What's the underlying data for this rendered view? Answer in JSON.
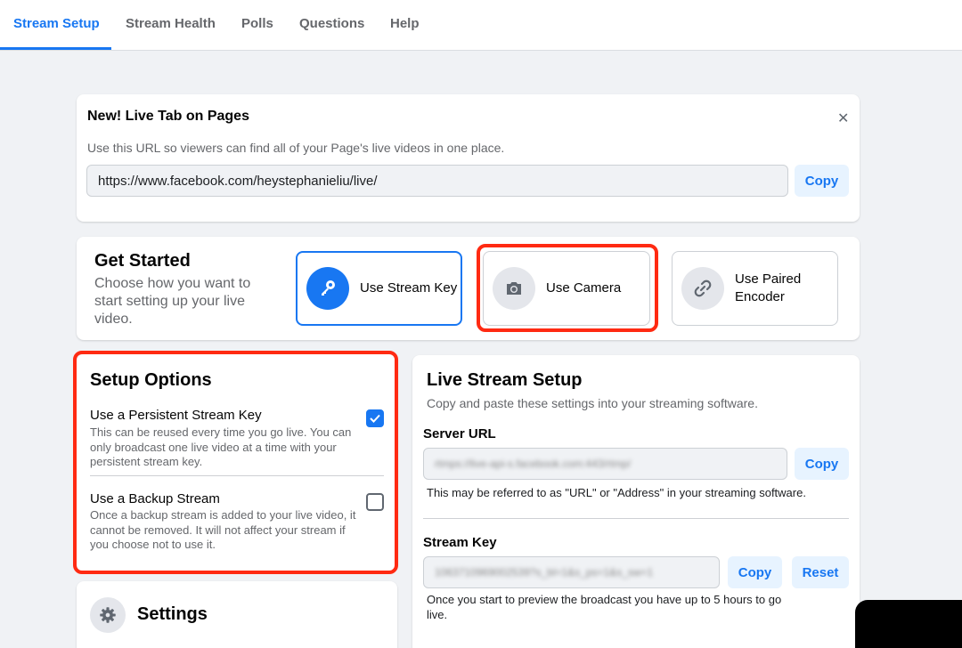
{
  "nav": {
    "tabs": [
      {
        "label": "Stream Setup",
        "active": true
      },
      {
        "label": "Stream Health",
        "active": false
      },
      {
        "label": "Polls",
        "active": false
      },
      {
        "label": "Questions",
        "active": false
      },
      {
        "label": "Help",
        "active": false
      }
    ]
  },
  "live_tab": {
    "title": "New! Live Tab on Pages",
    "close_icon": "close-icon",
    "description": "Use this URL so viewers can find all of your Page's live videos in one place.",
    "url": "https://www.facebook.com/heystephanieliu/live/",
    "copy_label": "Copy"
  },
  "get_started": {
    "title": "Get Started",
    "description": "Choose how you want to start setting up your live video.",
    "options": [
      {
        "label": "Use Stream Key",
        "icon": "key-icon",
        "selected": true
      },
      {
        "label": "Use Camera",
        "icon": "camera-icon",
        "selected": false
      },
      {
        "label": "Use Paired Encoder",
        "icon": "link-icon",
        "selected": false
      }
    ]
  },
  "setup_options": {
    "title": "Setup Options",
    "items": [
      {
        "title": "Use a Persistent Stream Key",
        "description": "This can be reused every time you go live. You can only broadcast one live video at a time with your persistent stream key.",
        "checked": true
      },
      {
        "title": "Use a Backup Stream",
        "description": "Once a backup stream is added to your live video, it cannot be removed. It will not affect your stream if you choose not to use it.",
        "checked": false
      }
    ]
  },
  "settings": {
    "title": "Settings",
    "icon": "gear-icon"
  },
  "live_stream_setup": {
    "title": "Live Stream Setup",
    "subtitle": "Copy and paste these settings into your streaming software.",
    "server_url": {
      "label": "Server URL",
      "value": "rtmps://live-api-s.facebook.com:443/rtmp/",
      "copy_label": "Copy",
      "help": "This may be referred to as \"URL\" or \"Address\" in your streaming software."
    },
    "stream_key": {
      "label": "Stream Key",
      "value": "1063710969002539?s_bl=1&s_ps=1&s_sw=1",
      "copy_label": "Copy",
      "reset_label": "Reset",
      "help": "Once you start to preview the broadcast you have up to 5 hours to go live."
    }
  },
  "colors": {
    "accent": "#1877f2",
    "highlight": "#ff2a12",
    "background": "#f0f2f5"
  }
}
